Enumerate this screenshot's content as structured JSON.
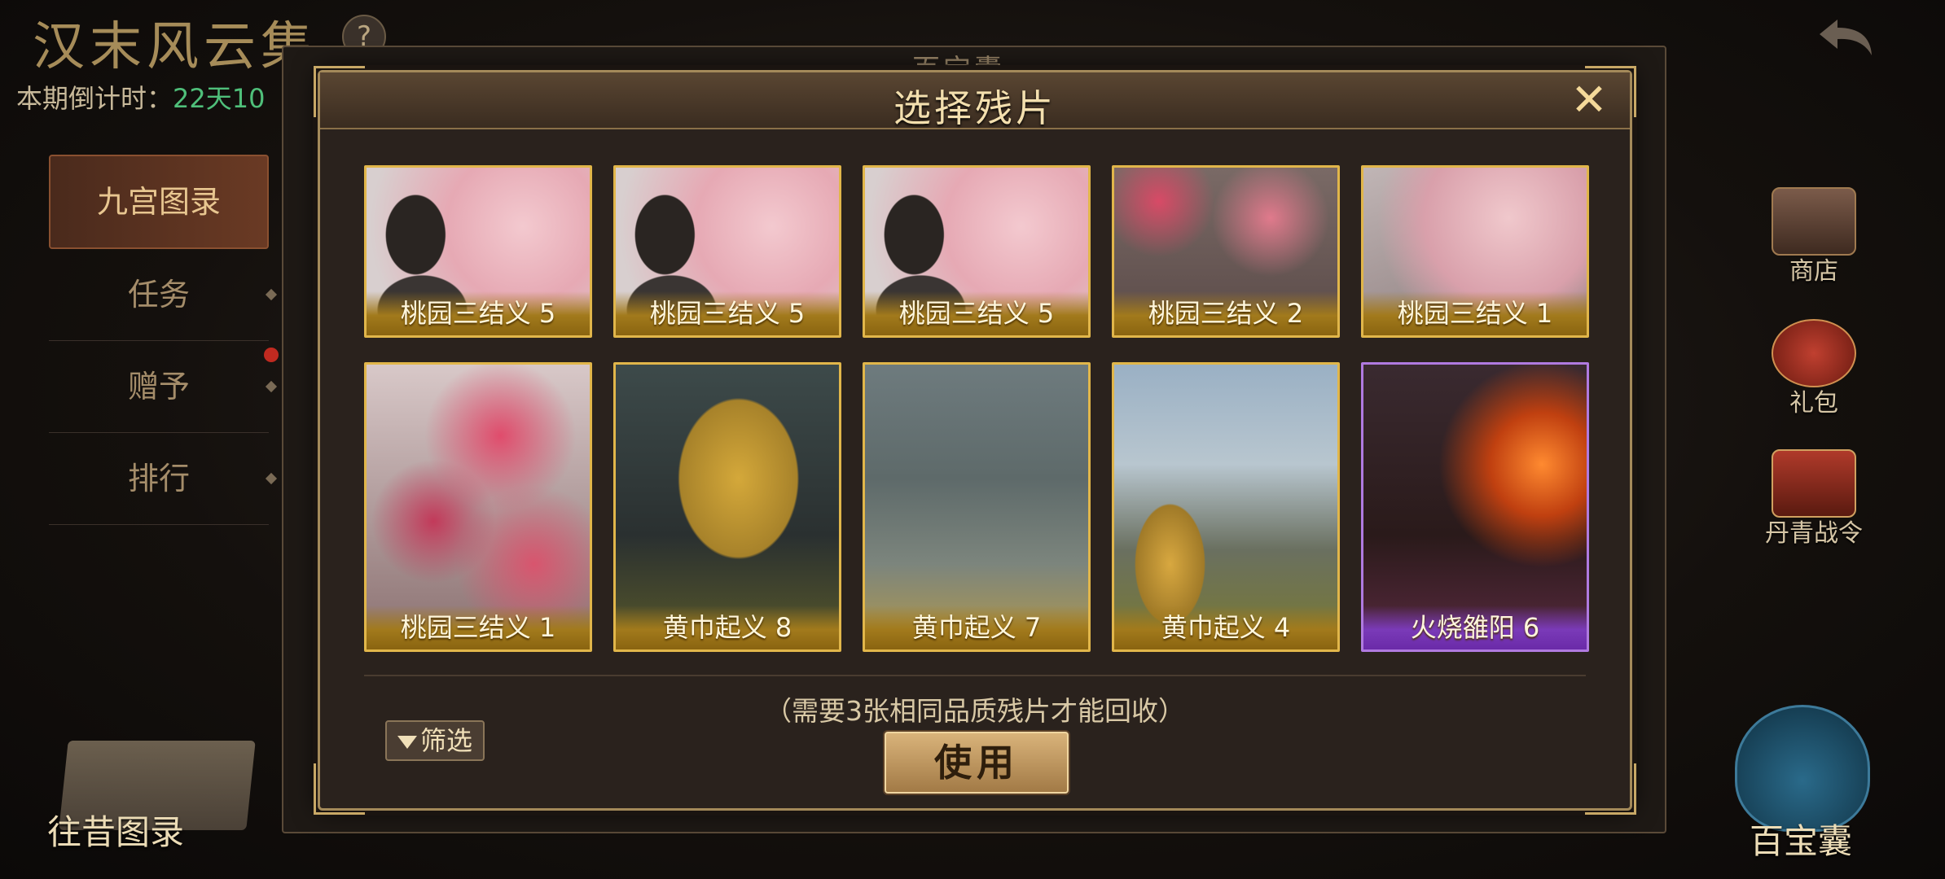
{
  "background": {
    "event_title": "汉末风云集",
    "help_icon": "question-icon",
    "countdown_label": "本期倒计时：",
    "countdown_value": "22天10",
    "panel_title": "百宝囊",
    "side_menu": [
      {
        "label": "九宫图录",
        "active": true
      },
      {
        "label": "任务",
        "active": false
      },
      {
        "label": "赠予",
        "active": false,
        "badge": true
      },
      {
        "label": "排行",
        "active": false
      }
    ],
    "bottom_left_label": "往昔图录",
    "right_menu": [
      {
        "label": "商店",
        "icon": "chest-icon"
      },
      {
        "label": "礼包",
        "icon": "gift-bag-icon"
      },
      {
        "label": "丹青战令",
        "icon": "battle-order-icon"
      }
    ],
    "bag_label": "百宝囊"
  },
  "modal": {
    "title": "选择残片",
    "close_icon": "close-icon",
    "cards": [
      {
        "label": "桃园三结义 5",
        "art": "art-peach-man",
        "rarity": "gold"
      },
      {
        "label": "桃园三结义 5",
        "art": "art-peach-man",
        "rarity": "gold"
      },
      {
        "label": "桃园三结义 5",
        "art": "art-peach-man",
        "rarity": "gold"
      },
      {
        "label": "桃园三结义 2",
        "art": "art-peach-gate",
        "rarity": "gold"
      },
      {
        "label": "桃园三结义 1",
        "art": "art-peach-branch",
        "rarity": "gold"
      },
      {
        "label": "桃园三结义 1",
        "art": "art-peach-big",
        "rarity": "gold"
      },
      {
        "label": "黄巾起义 8",
        "art": "art-yellow-robe",
        "rarity": "gold"
      },
      {
        "label": "黄巾起义 7",
        "art": "art-misty-army",
        "rarity": "gold"
      },
      {
        "label": "黄巾起义 4",
        "art": "art-raised-cup",
        "rarity": "gold"
      },
      {
        "label": "火烧雒阳 6",
        "art": "art-burning",
        "rarity": "purple"
      }
    ],
    "hint": "（需要3张相同品质残片才能回收）",
    "filter_label": "筛选",
    "use_label": "使用",
    "colors": {
      "gold_frame": "#e1b64a",
      "purple_frame": "#b07ae0",
      "button": "#d9b37a"
    }
  }
}
